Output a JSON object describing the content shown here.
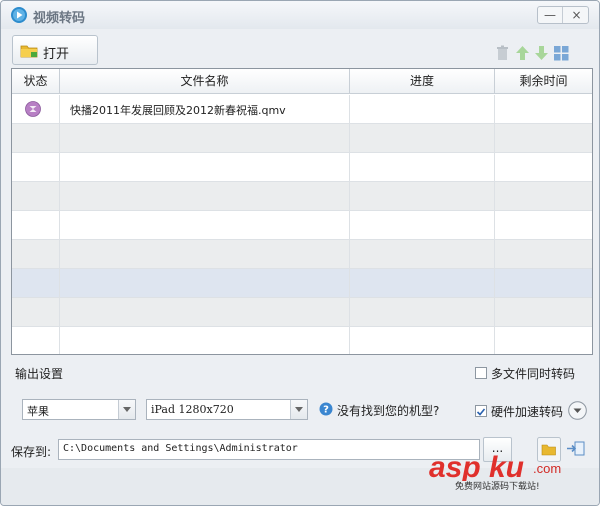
{
  "window": {
    "title": "视频转码",
    "min_label": "—",
    "close_label": "×"
  },
  "toolbar": {
    "open_label": "打开",
    "icons": [
      "delete-icon",
      "move-up-icon",
      "move-down-icon",
      "grid-view-icon"
    ]
  },
  "table": {
    "columns": [
      "状态",
      "文件名称",
      "进度",
      "剩余时间"
    ],
    "rows": [
      {
        "status_icon": "waiting-icon",
        "file": "快播2011年发展回顾及2012新春祝福.qmv",
        "progress": "",
        "remaining": ""
      }
    ],
    "empty_rows": 8,
    "selected_row": 6
  },
  "output": {
    "section_label": "输出设置",
    "multi_file_label": "多文件同时转码",
    "multi_file_checked": false,
    "brand_value": "苹果",
    "device_value": "iPad 1280x720",
    "help_text": "没有找到您的机型?",
    "hw_accel_label": "硬件加速转码",
    "hw_accel_checked": true
  },
  "save": {
    "label": "保存到:",
    "path": "C:\\Documents and Settings\\Administrator",
    "browse_label": "..."
  },
  "watermark": {
    "logo": "aspku.com",
    "tagline": "免费网站源码下载站!"
  },
  "colors": {
    "window_bg": "#eceff3",
    "selected_row": "#dee5f0",
    "alt_row": "#ebedee",
    "watermark_red": "#e0302c"
  }
}
